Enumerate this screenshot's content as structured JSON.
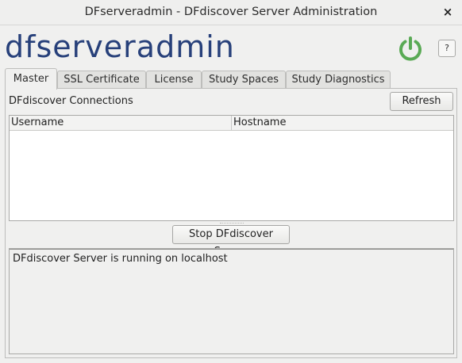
{
  "window": {
    "title": "DFserveradmin - DFdiscover Server Administration",
    "close_glyph": "×"
  },
  "header": {
    "logo_text": "dfserveradmin",
    "power_icon": "power-icon",
    "power_color": "#5aaa55",
    "help_label": "?"
  },
  "tabs": [
    {
      "label": "Master",
      "active": true
    },
    {
      "label": "SSL Certificate",
      "active": false
    },
    {
      "label": "License",
      "active": false
    },
    {
      "label": "Study Spaces",
      "active": false
    },
    {
      "label": "Study Diagnostics",
      "active": false
    }
  ],
  "master": {
    "connections_label": "DFdiscover Connections",
    "refresh_label": "Refresh",
    "table": {
      "columns": [
        "Username",
        "Hostname"
      ],
      "rows": []
    },
    "stop_label": "Stop DFdiscover Server",
    "status_text": "DFdiscover Server is running on localhost"
  },
  "colors": {
    "logo": "#27407a",
    "power": "#5aaa55"
  }
}
